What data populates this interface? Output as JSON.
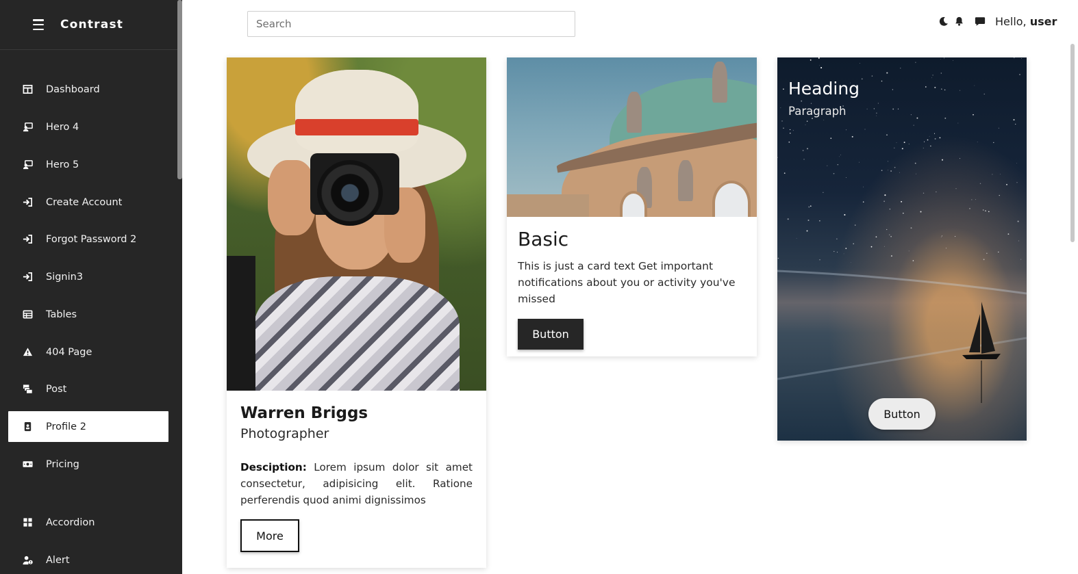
{
  "app": {
    "title": "Contrast"
  },
  "sidebar": {
    "items": [
      {
        "label": "Dashboard",
        "icon": "dashboard-icon"
      },
      {
        "label": "Hero 4",
        "icon": "user-screen-icon"
      },
      {
        "label": "Hero 5",
        "icon": "user-screen-icon"
      },
      {
        "label": "Create Account",
        "icon": "sign-in-icon"
      },
      {
        "label": "Forgot Password 2",
        "icon": "sign-in-icon"
      },
      {
        "label": "Signin3",
        "icon": "sign-in-icon"
      },
      {
        "label": "Tables",
        "icon": "table-icon"
      },
      {
        "label": "404 Page",
        "icon": "warning-icon"
      },
      {
        "label": "Post",
        "icon": "mail-bulk-icon"
      },
      {
        "label": "Profile 2",
        "icon": "id-badge-icon",
        "active": true
      },
      {
        "label": "Pricing",
        "icon": "money-bill-icon"
      },
      {
        "label": "Accordion",
        "icon": "grid-icon"
      },
      {
        "label": "Alert",
        "icon": "user-alert-icon"
      }
    ]
  },
  "header": {
    "search_placeholder": "Search",
    "greeting": "Hello,",
    "username": "user",
    "icons": [
      "moon-icon",
      "bell-icon",
      "message-icon"
    ]
  },
  "cards": {
    "profile": {
      "name": "Warren Briggs",
      "role": "Photographer",
      "desc_label": "Desciption:",
      "desc_text": " Lorem ipsum dolor sit amet consectetur, adipisicing elit. Ratione perferendis quod animi dignissimos",
      "button": "More"
    },
    "basic": {
      "title": "Basic",
      "text": "This is just a card text Get important notifications about you or activity you've missed",
      "button": "Button"
    },
    "overlay": {
      "heading": "Heading",
      "paragraph": "Paragraph",
      "button": "Button"
    }
  },
  "colors": {
    "sidebar_bg": "#262626",
    "dark_button": "#262626",
    "active_item_bg": "#ffffff"
  }
}
